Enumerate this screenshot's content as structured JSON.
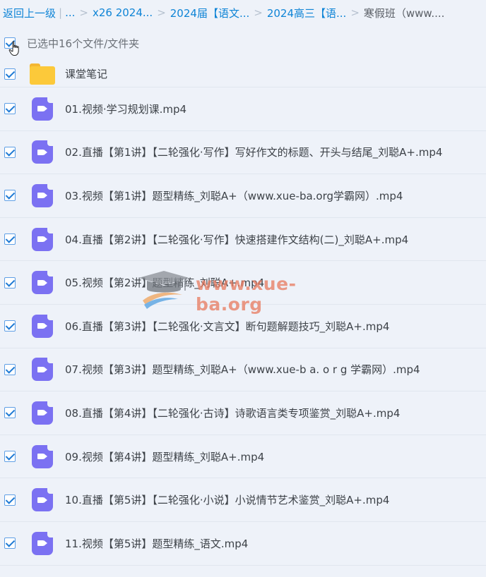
{
  "breadcrumb": {
    "back": "返回上一级",
    "ellipsis": "...",
    "crumbs": [
      "x26 2024...",
      "2024届【语文...",
      "2024高三【语..."
    ],
    "current": "寒假班（www...."
  },
  "selection": {
    "label": "已选中16个文件/文件夹"
  },
  "folder": {
    "name": "课堂笔记",
    "icon": "folder-icon"
  },
  "files": [
    "01.视频·学习规划课.mp4",
    "02.直播【第1讲】【二轮强化·写作】写好作文的标题、开头与结尾_刘聪A+.mp4",
    "03.视频【第1讲】题型精练_刘聪A+（www.xue-ba.org学霸网）.mp4",
    "04.直播【第2讲】【二轮强化·写作】快速搭建作文结构(二)_刘聪A+.mp4",
    "05.视频【第2讲】题型精练_刘聪A+.mp4",
    "06.直播【第3讲】【二轮强化·文言文】断句题解题技巧_刘聪A+.mp4",
    "07.视频【第3讲】题型精练_刘聪A+（www.xue-b a. o r g 学霸网）.mp4",
    "08.直播【第4讲】【二轮强化·古诗】诗歌语言类专项鉴赏_刘聪A+.mp4",
    "09.视频【第4讲】题型精练_刘聪A+.mp4",
    "10.直播【第5讲】【二轮强化·小说】小说情节艺术鉴赏_刘聪A+.mp4",
    "11.视频【第5讲】题型精练_语文.mp4"
  ],
  "watermark": {
    "text": "www.xue-ba.org"
  },
  "colors": {
    "link": "#0e84d6",
    "video_icon": "#7b71f2",
    "folder": "#fcc93a",
    "background": "#eef2f9"
  }
}
